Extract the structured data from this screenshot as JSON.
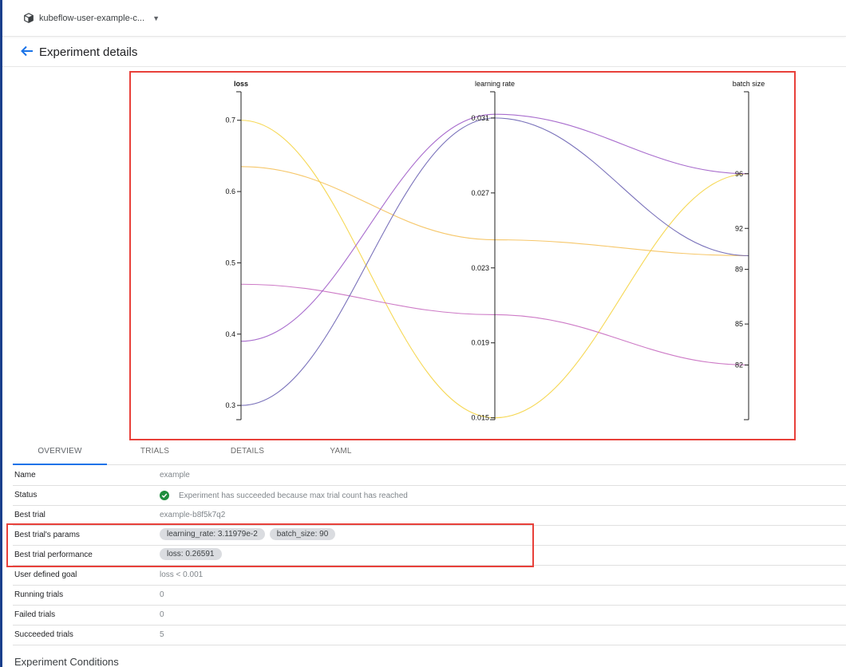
{
  "header": {
    "namespace": "kubeflow-user-example-c..."
  },
  "title": {
    "label": "Experiment details"
  },
  "chart_data": {
    "type": "parallel-coordinates",
    "axes": [
      {
        "name": "loss",
        "range": [
          0.28,
          0.74
        ],
        "ticks": [
          "0.3",
          "0.4",
          "0.5",
          "0.6",
          "0.7"
        ]
      },
      {
        "name": "learning rate",
        "range": [
          0.0149,
          0.0324
        ],
        "ticks": [
          "0.015",
          "0.019",
          "0.023",
          "0.027",
          "0.031"
        ]
      },
      {
        "name": "batch size",
        "range": [
          78,
          102
        ],
        "ticks": [
          "82",
          "85",
          "89",
          "92",
          "96"
        ]
      }
    ],
    "series": [
      {
        "loss": 0.7,
        "lr": 0.015,
        "batch": 96,
        "color": "#f5d442"
      },
      {
        "loss": 0.635,
        "lr": 0.0245,
        "batch": 90,
        "color": "#f5c15a"
      },
      {
        "loss": 0.47,
        "lr": 0.0205,
        "batch": 82,
        "color": "#c86bc0"
      },
      {
        "loss": 0.39,
        "lr": 0.0312,
        "batch": 96,
        "color": "#9f5cc8"
      },
      {
        "loss": 0.3,
        "lr": 0.031,
        "batch": 90,
        "color": "#6a62b3"
      }
    ]
  },
  "tabs": [
    {
      "label": "OVERVIEW",
      "active": true
    },
    {
      "label": "TRIALS"
    },
    {
      "label": "DETAILS"
    },
    {
      "label": "YAML"
    }
  ],
  "details": {
    "name": {
      "key": "Name",
      "value": "example"
    },
    "status": {
      "key": "Status",
      "value": "Experiment has succeeded because max trial count has reached"
    },
    "best_trial": {
      "key": "Best trial",
      "value": "example-b8f5k7q2"
    },
    "best_params": {
      "key": "Best trial's params",
      "chips": [
        "learning_rate: 3.11979e-2",
        "batch_size: 90"
      ]
    },
    "best_performance": {
      "key": "Best trial performance",
      "chips": [
        "loss: 0.26591"
      ]
    },
    "goal": {
      "key": "User defined goal",
      "value": "loss < 0.001"
    },
    "running": {
      "key": "Running trials",
      "value": "0"
    },
    "failed": {
      "key": "Failed trials",
      "value": "0"
    },
    "succeeded": {
      "key": "Succeeded trials",
      "value": "5"
    }
  },
  "conditions": {
    "heading": "Experiment Conditions"
  },
  "colors": {
    "accent": "#1a73e8",
    "highlight": "#e8403a",
    "success": "#1e8e3e"
  }
}
